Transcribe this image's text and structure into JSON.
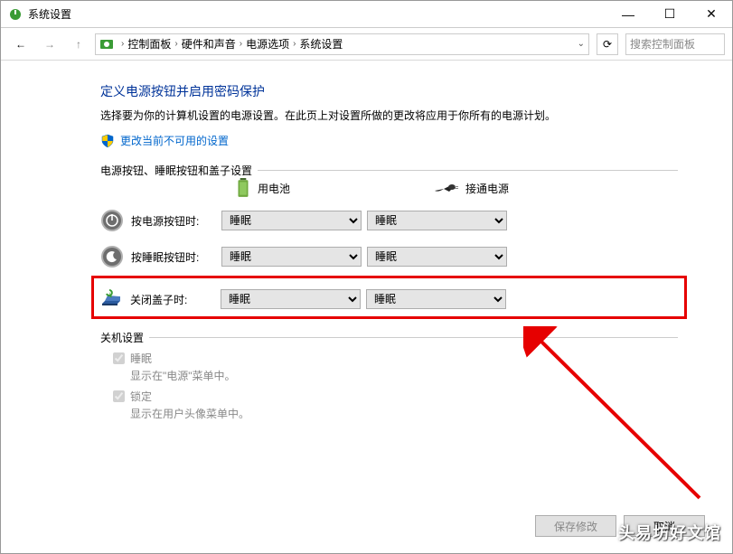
{
  "window": {
    "title": "系统设置"
  },
  "breadcrumb": {
    "items": [
      "控制面板",
      "硬件和声音",
      "电源选项",
      "系统设置"
    ]
  },
  "search": {
    "placeholder": "搜索控制面板"
  },
  "header": {
    "title": "定义电源按钮并启用密码保护",
    "desc": "选择要为你的计算机设置的电源设置。在此页上对设置所做的更改将应用于你所有的电源计划。",
    "change_link": "更改当前不可用的设置"
  },
  "fieldset1": {
    "legend": "电源按钮、睡眠按钮和盖子设置",
    "col_battery": "用电池",
    "col_plugged": "接通电源",
    "rows": [
      {
        "label": "按电源按钮时:",
        "val_battery": "睡眠",
        "val_plugged": "睡眠"
      },
      {
        "label": "按睡眠按钮时:",
        "val_battery": "睡眠",
        "val_plugged": "睡眠"
      },
      {
        "label": "关闭盖子时:",
        "val_battery": "睡眠",
        "val_plugged": "睡眠"
      }
    ]
  },
  "fieldset2": {
    "legend": "关机设置",
    "sleep": {
      "label": "睡眠",
      "sub": "显示在\"电源\"菜单中。"
    },
    "lock": {
      "label": "锁定",
      "sub": "显示在用户头像菜单中。"
    }
  },
  "footer": {
    "save": "保存修改",
    "cancel": "取消"
  },
  "watermark": "头易坊好文馆"
}
